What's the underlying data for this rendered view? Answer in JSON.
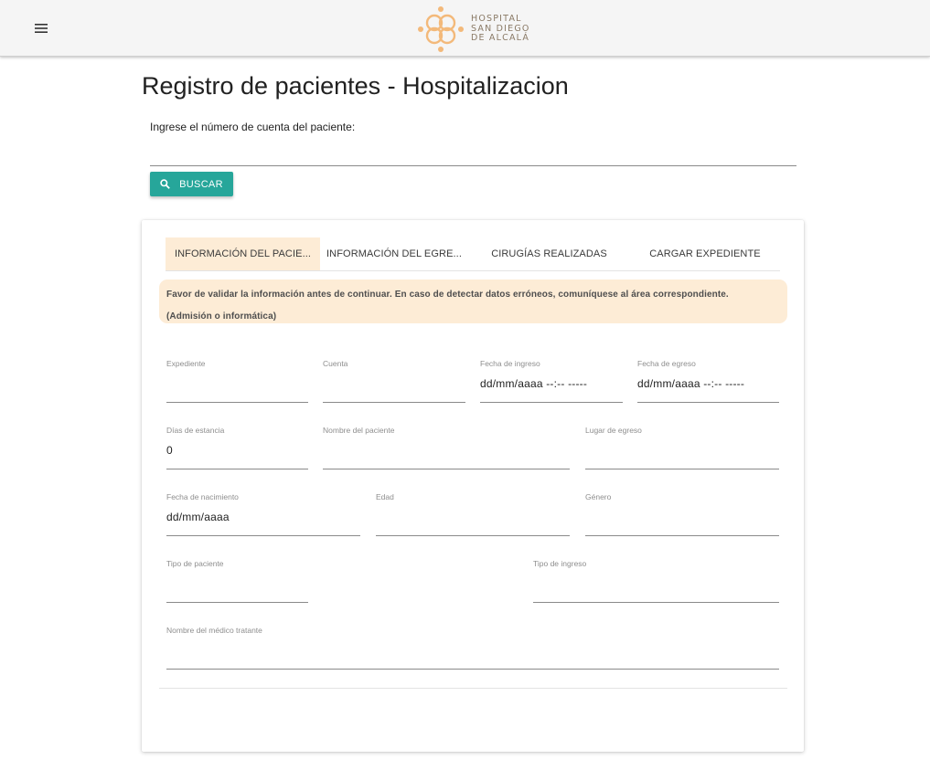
{
  "header": {
    "menu_icon": "hamburger-menu-icon",
    "logo_icon": "hospital-logo-icon",
    "logo_lines": [
      "HOSPITAL",
      "SAN DIEGO",
      "DE ALCALÁ"
    ],
    "bar_color": "#f5f5f5",
    "logo_color": "#f3b97a"
  },
  "page": {
    "title": "Registro de pacientes - Hospitalizacion"
  },
  "search": {
    "label": "Ingrese el número de cuenta del paciente:",
    "value": "",
    "button_label": "BUSCAR",
    "button_icon": "search-icon",
    "button_color": "#26a69a"
  },
  "tabs": [
    {
      "label": "INFORMACIÓN DEL PACIE...",
      "active": true
    },
    {
      "label": "INFORMACIÓN DEL EGRE...",
      "active": false
    },
    {
      "label": "CIRUGÍAS REALIZADAS",
      "active": false
    },
    {
      "label": "CARGAR EXPEDIENTE",
      "active": false
    }
  ],
  "alert": {
    "line1": "Favor de validar la información antes de continuar. En caso de detectar datos erróneos, comuníquese al área correspondiente.",
    "line2": "(Admisión o informática)",
    "background": "#fdecd6"
  },
  "form": {
    "expediente": {
      "label": "Expediente",
      "value": ""
    },
    "cuenta": {
      "label": "Cuenta",
      "value": ""
    },
    "fecha_ingreso": {
      "label": "Fecha de ingreso",
      "value": "dd/mm/aaaa --:-- -----"
    },
    "fecha_egreso": {
      "label": "Fecha de egreso",
      "value": "dd/mm/aaaa --:-- -----"
    },
    "dias_estancia": {
      "label": "Días de estancia",
      "value": "0"
    },
    "nombre_paciente": {
      "label": "Nombre del paciente",
      "value": ""
    },
    "lugar_egreso": {
      "label": "Lugar de egreso",
      "value": ""
    },
    "fecha_nacimiento": {
      "label": "Fecha de nacimiento",
      "value": "dd/mm/aaaa"
    },
    "edad": {
      "label": "Edad",
      "value": ""
    },
    "genero": {
      "label": "Género",
      "value": ""
    },
    "tipo_paciente": {
      "label": "Tipo de paciente",
      "value": ""
    },
    "tipo_ingreso": {
      "label": "Tipo de ingreso",
      "value": ""
    },
    "medico_tratante": {
      "label": "Nombre del médico tratante",
      "value": ""
    }
  }
}
